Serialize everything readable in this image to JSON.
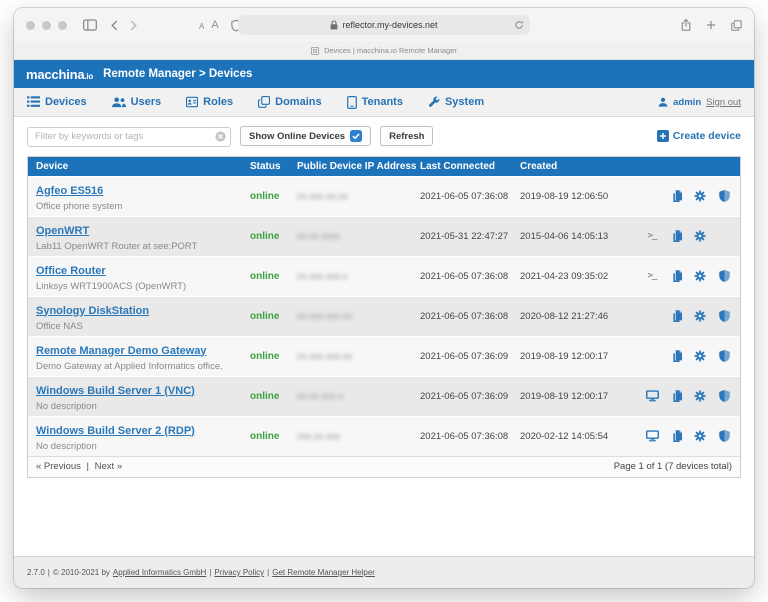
{
  "browser": {
    "url": "reflector.my-devices.net",
    "tab_title": "Devices | macchina.io Remote Manager",
    "text_size_small": "A",
    "text_size_large": "A"
  },
  "app": {
    "logo": "macchina",
    "logo_suffix": ".io",
    "title": "Remote Manager > Devices"
  },
  "nav": {
    "items": [
      {
        "label": "Devices",
        "icon": "list-icon"
      },
      {
        "label": "Users",
        "icon": "users-icon"
      },
      {
        "label": "Roles",
        "icon": "id-card-icon"
      },
      {
        "label": "Domains",
        "icon": "clone-icon"
      },
      {
        "label": "Tenants",
        "icon": "tablet-icon"
      },
      {
        "label": "System",
        "icon": "wrench-icon"
      }
    ],
    "user": "admin",
    "sign_out": "Sign out"
  },
  "toolbar": {
    "filter_placeholder": "Filter by keywords or tags",
    "show_online_label": "Show Online Devices",
    "refresh_label": "Refresh",
    "create_label": "Create device"
  },
  "table": {
    "columns": [
      "Device",
      "Status",
      "Public Device IP Address",
      "Last Connected",
      "Created"
    ],
    "rows": [
      {
        "name": "Agfeo ES516",
        "description": "Office phone system",
        "status": "online",
        "ip_masked": "xx.xxx.xx.xx",
        "last_connected": "2021-06-05 07:36:08",
        "created": "2019-08-19 12:06:50",
        "remote_icon": "",
        "actions": [
          "copy",
          "gear",
          "shield"
        ]
      },
      {
        "name": "OpenWRT",
        "description": "Lab11 OpenWRT Router at see:PORT",
        "status": "online",
        "ip_masked": "xx.xx.xxxx",
        "last_connected": "2021-05-31 22:47:27",
        "created": "2015-04-06 14:05:13",
        "remote_icon": "terminal",
        "actions": [
          "copy",
          "gear"
        ]
      },
      {
        "name": "Office Router",
        "description": "Linksys WRT1900ACS (OpenWRT)",
        "status": "online",
        "ip_masked": "xx.xxx.xxx.x",
        "last_connected": "2021-06-05 07:36:08",
        "created": "2021-04-23 09:35:02",
        "remote_icon": "terminal",
        "actions": [
          "copy",
          "gear",
          "shield"
        ]
      },
      {
        "name": "Synology DiskStation",
        "description": "Office NAS",
        "status": "online",
        "ip_masked": "xx.xxx.xxx.xx",
        "last_connected": "2021-06-05 07:36:08",
        "created": "2020-08-12 21:27:46",
        "remote_icon": "",
        "actions": [
          "copy",
          "gear",
          "shield"
        ]
      },
      {
        "name": "Remote Manager Demo Gateway",
        "description": "Demo Gateway at Applied Informatics office.",
        "status": "online",
        "ip_masked": "xx.xxx.xxx.xx",
        "last_connected": "2021-06-05 07:36:09",
        "created": "2019-08-19 12:00:17",
        "remote_icon": "",
        "actions": [
          "copy",
          "gear",
          "shield"
        ]
      },
      {
        "name": "Windows Build Server 1 (VNC)",
        "description": "No description",
        "status": "online",
        "ip_masked": "xx.xx.xxx.x",
        "last_connected": "2021-06-05 07:36:09",
        "created": "2019-08-19 12:00:17",
        "remote_icon": "desktop",
        "actions": [
          "copy",
          "gear",
          "shield"
        ]
      },
      {
        "name": "Windows Build Server 2 (RDP)",
        "description": "No description",
        "status": "online",
        "ip_masked": "xxx.xx.xxx",
        "last_connected": "2021-06-05 07:36:08",
        "created": "2020-02-12 14:05:54",
        "remote_icon": "desktop",
        "actions": [
          "copy",
          "gear",
          "shield"
        ]
      }
    ]
  },
  "pagination": {
    "previous": "« Previous",
    "separator": "|",
    "next": "Next »",
    "info": "Page 1 of 1 (7 devices total)"
  },
  "footer": {
    "version": "2.7.0",
    "sep": "|",
    "copyright": "© 2010-2021 by",
    "company_link": "Applied Informatics GmbH",
    "privacy_link": "Privacy Policy",
    "helper_link": "Get Remote Manager Helper"
  },
  "colors": {
    "accent_blue": "#1d73b9",
    "link_blue": "#2a78ba",
    "online_green": "#3da03f"
  }
}
